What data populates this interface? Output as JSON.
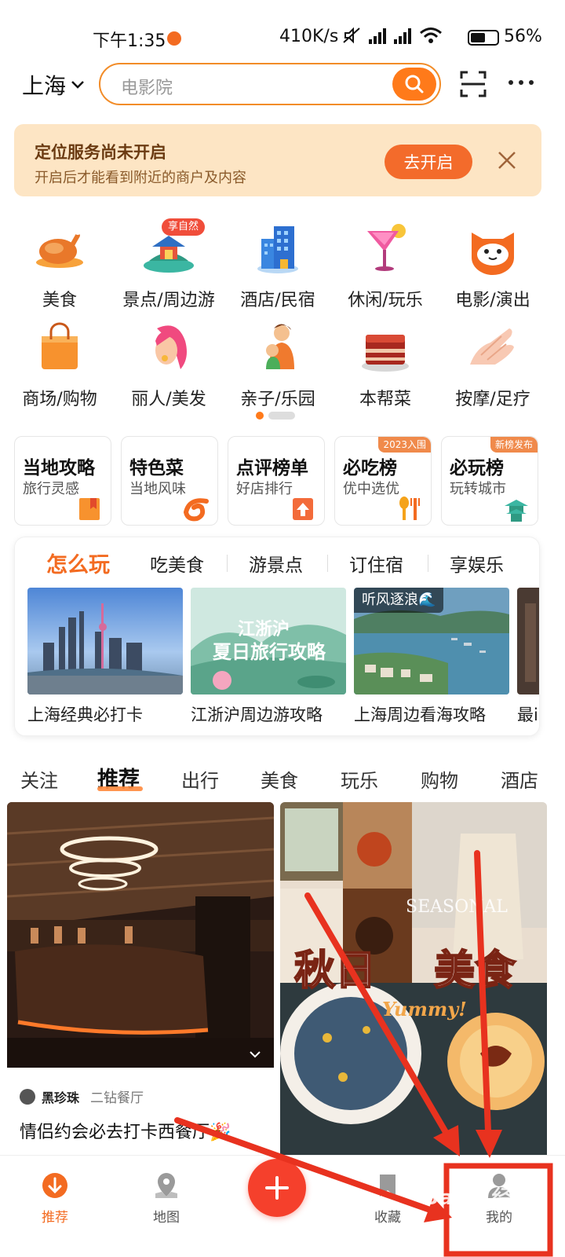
{
  "status_bar": {
    "time": "下午1:35",
    "network_speed": "410K/s",
    "battery": "56%"
  },
  "header": {
    "city": "上海",
    "search_placeholder": "电影院"
  },
  "location_banner": {
    "title": "定位服务尚未开启",
    "subtitle": "开启后才能看到附近的商户及内容",
    "button": "去开启"
  },
  "categories": [
    {
      "label": "美食",
      "icon": "roast-chicken-icon"
    },
    {
      "label": "景点/周边游",
      "icon": "pavilion-icon",
      "badge": "享自然"
    },
    {
      "label": "酒店/民宿",
      "icon": "hotel-building-icon"
    },
    {
      "label": "休闲/玩乐",
      "icon": "cocktail-icon"
    },
    {
      "label": "电影/演出",
      "icon": "cat-face-icon"
    },
    {
      "label": "商场/购物",
      "icon": "shopping-bag-icon"
    },
    {
      "label": "丽人/美发",
      "icon": "woman-hair-icon"
    },
    {
      "label": "亲子/乐园",
      "icon": "mother-child-icon"
    },
    {
      "label": "本帮菜",
      "icon": "braised-pork-icon"
    },
    {
      "label": "按摩/足疗",
      "icon": "massage-hand-icon"
    }
  ],
  "feature_cards": [
    {
      "title": "当地攻略",
      "subtitle": "旅行灵感",
      "tag": "",
      "icon": "bookmark-icon"
    },
    {
      "title": "特色菜",
      "subtitle": "当地风味",
      "tag": "",
      "icon": "shrimp-icon"
    },
    {
      "title": "点评榜单",
      "subtitle": "好店排行",
      "tag": "",
      "icon": "upload-rank-icon"
    },
    {
      "title": "必吃榜",
      "subtitle": "优中选优",
      "tag": "2023入围",
      "icon": "fork-spoon-icon"
    },
    {
      "title": "必玩榜",
      "subtitle": "玩转城市",
      "tag": "新榜发布",
      "icon": "pagoda-icon"
    }
  ],
  "play_panel": {
    "tabs": [
      "怎么玩",
      "吃美食",
      "游景点",
      "订住宿",
      "享娱乐"
    ],
    "cards": [
      {
        "caption": "上海经典必打卡",
        "overlay": ""
      },
      {
        "caption": "江浙沪周边游攻略",
        "overlay": ""
      },
      {
        "caption": "上海周边看海攻略",
        "overlay": "听风逐浪🌊"
      },
      {
        "caption": "最i",
        "overlay": ""
      }
    ],
    "poster_text": {
      "line1": "江浙沪",
      "line2": "夏日旅行攻略"
    }
  },
  "feed_tabs": [
    "关注",
    "推荐",
    "出行",
    "美食",
    "玩乐",
    "购物",
    "酒店"
  ],
  "feed": {
    "left": {
      "brand": "黑珍珠",
      "category": "二钻餐厅",
      "title": "情侣约会必去打卡西餐厅🎉"
    },
    "right": {
      "headline_a": "秋日",
      "headline_b": "美食",
      "script": "Yummy!",
      "overlay_en": "SEASONAL"
    }
  },
  "bottom_nav": {
    "recommend": "推荐",
    "map": "地图",
    "favorites": "收藏",
    "mine": "我的"
  },
  "watermark": "Baidu经验",
  "colors": {
    "accent": "#f36b21",
    "banner_bg": "#fde5c4",
    "annotation_red": "#e8321f"
  }
}
